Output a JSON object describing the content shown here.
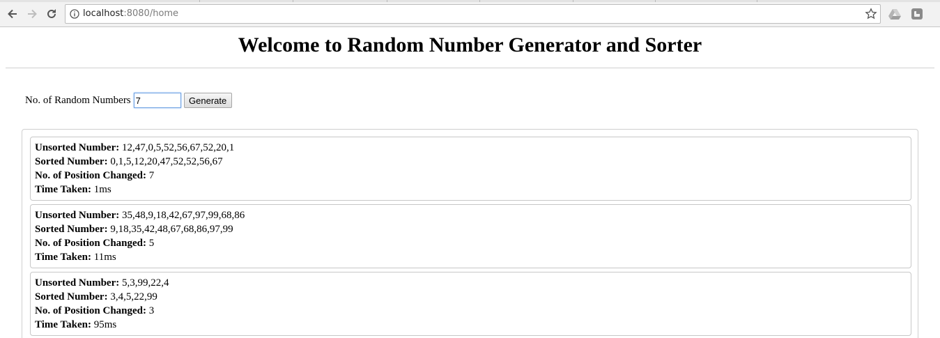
{
  "browser": {
    "url_host": "localhost",
    "url_rest": ":8080/home"
  },
  "page": {
    "title": "Welcome to Random Number Generator and Sorter",
    "form": {
      "label": "No. of Random Numbers",
      "input_value": "7",
      "generate_label": "Generate"
    },
    "field_labels": {
      "unsorted": "Unsorted Number:",
      "sorted": "Sorted Number:",
      "changed": "No. of Position Changed:",
      "time": "Time Taken:"
    },
    "results": [
      {
        "unsorted": "12,47,0,5,52,56,67,52,20,1",
        "sorted": "0,1,5,12,20,47,52,52,56,67",
        "changed": "7",
        "time": "1ms"
      },
      {
        "unsorted": "35,48,9,18,42,67,97,99,68,86",
        "sorted": "9,18,35,42,48,67,68,86,97,99",
        "changed": "5",
        "time": "11ms"
      },
      {
        "unsorted": "5,3,99,22,4",
        "sorted": "3,4,5,22,99",
        "changed": "3",
        "time": "95ms"
      }
    ]
  }
}
